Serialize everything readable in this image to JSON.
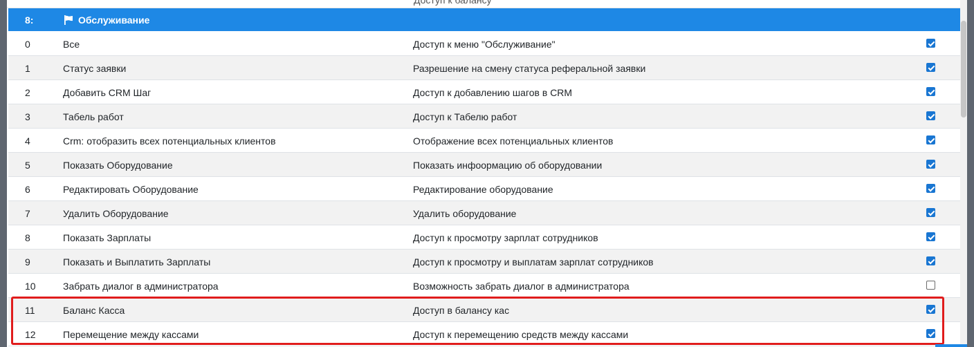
{
  "top_partial_text": "Доступ к балансу",
  "group": {
    "number": "8:",
    "icon": "flag-icon",
    "title": "Обслуживание"
  },
  "colors": {
    "header": "#1e88e5",
    "checkbox": "#1976d2",
    "highlight": "#e01c1c"
  },
  "rows": [
    {
      "num": "0",
      "name": "Все",
      "desc": "Доступ к меню \"Обслуживание\"",
      "checked": true
    },
    {
      "num": "1",
      "name": "Статус заявки",
      "desc": "Разрешение на смену статуса реферальной заявки",
      "checked": true
    },
    {
      "num": "2",
      "name": "Добавить CRM Шаг",
      "desc": "Доступ к добавлению шагов в CRM",
      "checked": true
    },
    {
      "num": "3",
      "name": "Табель работ",
      "desc": "Доступ к Табелю работ",
      "checked": true
    },
    {
      "num": "4",
      "name": "Crm: отобразить всех потенциальных клиентов",
      "desc": "Отображение всех потенциальных клиентов",
      "checked": true
    },
    {
      "num": "5",
      "name": "Показать Оборудование",
      "desc": "Показать инфоормацию об оборудовании",
      "checked": true
    },
    {
      "num": "6",
      "name": "Редактировать Оборудование",
      "desc": "Редактирование оборудование",
      "checked": true
    },
    {
      "num": "7",
      "name": "Удалить Оборудование",
      "desc": "Удалить оборудование",
      "checked": true
    },
    {
      "num": "8",
      "name": "Показать Зарплаты",
      "desc": "Доступ к просмотру зарплат сотрудников",
      "checked": true
    },
    {
      "num": "9",
      "name": "Показать и Выплатить Зарплаты",
      "desc": "Доступ к просмотру и выплатам зарплат сотрудников",
      "checked": true
    },
    {
      "num": "10",
      "name": "Забрать диалог в администратора",
      "desc": "Возможность забрать диалог в администратора",
      "checked": false
    },
    {
      "num": "11",
      "name": "Баланс Касса",
      "desc": "Доступ в балансу кас",
      "checked": true
    },
    {
      "num": "12",
      "name": "Перемещение между кассами",
      "desc": "Доступ к перемещению средств между кассами",
      "checked": true
    }
  ]
}
